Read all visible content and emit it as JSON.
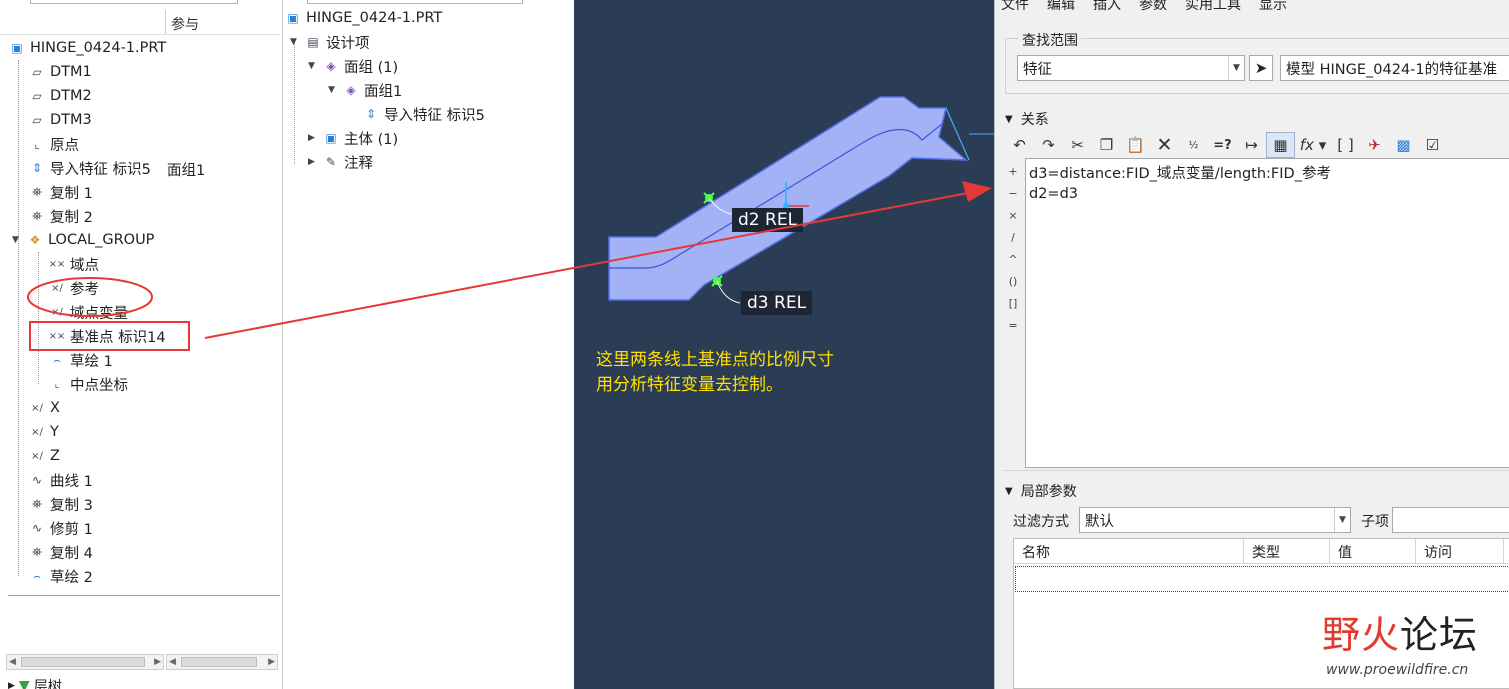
{
  "tree": {
    "column_header": "参与",
    "items": [
      {
        "label": "HINGE_0424-1.PRT",
        "icon": "part-icon"
      },
      {
        "label": "DTM1",
        "icon": "datum-plane-icon"
      },
      {
        "label": "DTM2",
        "icon": "datum-plane-icon"
      },
      {
        "label": "DTM3",
        "icon": "datum-plane-icon"
      },
      {
        "label": "原点",
        "icon": "coordinate-system-icon"
      },
      {
        "label": "导入特征 标识5",
        "icon": "import-feature-icon",
        "extra": "面组1"
      },
      {
        "label": "复制 1",
        "icon": "copy-surface-icon"
      },
      {
        "label": "复制 2",
        "icon": "copy-surface-icon"
      },
      {
        "label": "LOCAL_GROUP",
        "icon": "group-icon"
      },
      {
        "label": "域点",
        "icon": "datum-point-icon"
      },
      {
        "label": "参考",
        "icon": "analysis-feature-icon"
      },
      {
        "label": "域点变量",
        "icon": "analysis-feature-icon"
      },
      {
        "label": "基准点 标识14",
        "icon": "datum-point-icon"
      },
      {
        "label": "草绘 1",
        "icon": "sketch-icon"
      },
      {
        "label": "中点坐标",
        "icon": "analysis-feature-icon"
      },
      {
        "label": "X",
        "icon": "analysis-feature-icon"
      },
      {
        "label": "Y",
        "icon": "analysis-feature-icon"
      },
      {
        "label": "Z",
        "icon": "analysis-feature-icon"
      },
      {
        "label": "曲线 1",
        "icon": "curve-icon"
      },
      {
        "label": "复制 3",
        "icon": "copy-surface-icon"
      },
      {
        "label": "修剪 1",
        "icon": "trim-icon"
      },
      {
        "label": "复制 4",
        "icon": "copy-surface-icon"
      },
      {
        "label": "草绘 2",
        "icon": "sketch-icon"
      }
    ],
    "bottom_tab": "层树"
  },
  "mid": {
    "items": [
      {
        "label": "HINGE_0424-1.PRT",
        "icon": "part-icon"
      },
      {
        "label": "设计项",
        "icon": "design-items-icon"
      },
      {
        "label": "面组 (1)",
        "icon": "quilt-icon"
      },
      {
        "label": "面组1",
        "icon": "quilt-icon"
      },
      {
        "label": "导入特征 标识5",
        "icon": "import-feature-icon"
      },
      {
        "label": "主体 (1)",
        "icon": "body-icon"
      },
      {
        "label": "注释",
        "icon": "annotation-icon"
      }
    ]
  },
  "viewport": {
    "dim_d2": "d2 REL",
    "dim_d3": "d3 REL",
    "note_line1": "这里两条线上基准点的比例尺寸",
    "note_line2": "用分析特征变量去控制。",
    "colors": {
      "background": "#2b3d55",
      "part": "#a3b1f5",
      "annotation": "#ffe000",
      "arrow": "#e53935"
    }
  },
  "dialog": {
    "menu": [
      "文件",
      "编辑",
      "插入",
      "参数",
      "实用工具",
      "显示"
    ],
    "scope_title": "查找范围",
    "scope_value": "特征",
    "model_value": "模型 HINGE_0424-1的特征基准",
    "relations_title": "关系",
    "toolbar_icons": [
      "undo-icon",
      "redo-icon",
      "cut-icon",
      "copy-icon",
      "paste-icon",
      "delete-icon",
      "numeric-icon",
      "evaluate-icon",
      "dimension-icon",
      "display-icon",
      "function-icon",
      "brackets-icon",
      "verify-icon",
      "sort-icon",
      "properties-icon"
    ],
    "operators": [
      "+",
      "−",
      "×",
      "/",
      "^",
      "()",
      "[]",
      "="
    ],
    "relations": [
      "d3=distance:FID_域点变量/length:FID_参考",
      "d2=d3"
    ],
    "local_params_title": "局部参数",
    "filter_label": "过滤方式",
    "filter_value": "默认",
    "subitem_label": "子项",
    "columns": [
      "名称",
      "类型",
      "值",
      "访问"
    ],
    "watermark_title_red": "野火",
    "watermark_title_black": "论坛",
    "watermark_url": "www.proewildfire.cn"
  }
}
